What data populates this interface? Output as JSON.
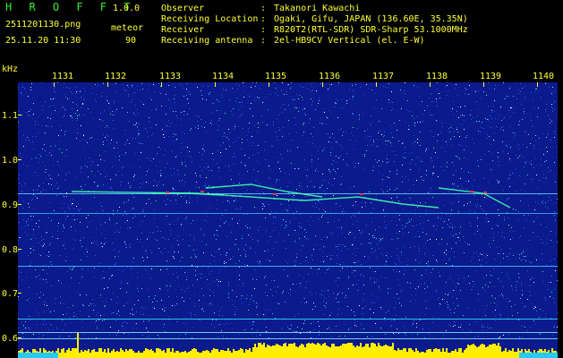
{
  "header": {
    "app_title": "H R O F F T",
    "version": "1.0.0",
    "file_name": "2511201130.png",
    "datetime": "25.11.20 11:30",
    "mode_label": "meteor",
    "mode_value": "90"
  },
  "info": [
    {
      "label": "Observer",
      "value": "Takanori Kawachi"
    },
    {
      "label": "Receiving Location",
      "value": "Ogaki, Gifu, JAPAN (136.60E, 35.35N)"
    },
    {
      "label": "Receiver",
      "value": "R820T2(RTL-SDR) SDR-Sharp 53.1000MHz"
    },
    {
      "label": "Receiving antenna",
      "value": "2el-HB9CV Vertical (el. E-W)"
    }
  ],
  "axes": {
    "unit": "kHz",
    "time_ticks": [
      "1131",
      "1132",
      "1133",
      "1134",
      "1135",
      "1136",
      "1137",
      "1138",
      "1139",
      "1140"
    ],
    "freq_ticks": [
      "1.1",
      "1.0",
      "0.9",
      "0.8",
      "0.7",
      "0.6"
    ]
  },
  "colors": {
    "background": "#000000",
    "text_yellow": "#ffff33",
    "text_green": "#33ee33",
    "spectrogram_base": "#0b1a8c",
    "noise_level_bar": "#ffee00",
    "noise_floor_bar": "#22ccff"
  }
}
